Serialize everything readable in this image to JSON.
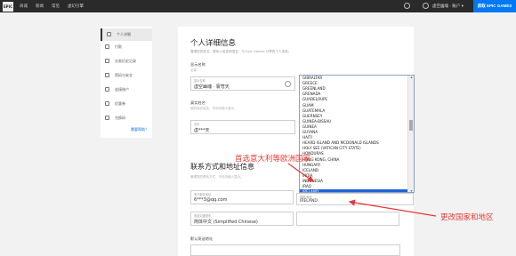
{
  "nav": {
    "logo": "EPIC",
    "links": [
      "商城",
      "新闻",
      "常见",
      "虚幻引擎"
    ],
    "username": "虚空幽魂 · 账户 ▾",
    "get_button": "获取 EPIC GAMES"
  },
  "sidebar": {
    "items": [
      {
        "label": "个人详细",
        "icon": "person-icon",
        "active": true
      },
      {
        "label": "付款",
        "icon": "card-icon"
      },
      {
        "label": "交易历史记录",
        "icon": "history-icon"
      },
      {
        "label": "密码与安全",
        "icon": "key-icon"
      },
      {
        "label": "连接账户",
        "icon": "link-icon"
      },
      {
        "label": "优惠券",
        "icon": "coupon-icon"
      },
      {
        "label": "兑换码",
        "icon": "redeem-icon"
      }
    ],
    "help": "需要帮助？"
  },
  "main": {
    "title": "个人详细信息",
    "desc": "管理您的姓名、联系人信息和语言，与 Epic Games 分享的个人信息。",
    "display_name_label": "显示名称",
    "display_name_sub": "必填",
    "display_name_field_label": "显示名称",
    "display_name_value": "虚空幽魂 · 寰穹天",
    "real_name_label": "真实姓名",
    "real_name_sub": "您的真实姓名，不可向他人显示。",
    "real_name_field_label": "名字",
    "real_name_value": "虚***天",
    "contact_title": "联系方式和地址信息",
    "contact_sub": "管理您的联系方式，不可向他人显示。",
    "email_field_label": "电子邮件地址",
    "email_value": "6***3@qq.com",
    "language_field_label": "首选沟通语言",
    "language_value": "简体中文 (Simplified Chinese)",
    "address_label": "默认寄送地址"
  },
  "dropdown": {
    "options": [
      "GIBRALTAR",
      "GREECE",
      "GREENLAND",
      "GRENADA",
      "GUADELOUPE",
      "GUAM",
      "GUATEMALA",
      "GUERNSEY",
      "GUINEA-BISSAU",
      "GUINEA",
      "GUYANA",
      "HAITI",
      "HEARD ISLAND AND MCDONALD ISLANDS",
      "HOLY SEE (VATICAN CITY STATE)",
      "HONDURAS",
      "HONG KONG, CHINA",
      "HUNGARY",
      "ICELAND",
      "INDIA",
      "INDONESIA",
      "IRAQ",
      "IRELAND"
    ],
    "selected": "IRELAND"
  },
  "country_select": {
    "label": "国家/地区",
    "value": "IRELAND"
  },
  "annotations": {
    "left": "首选意大利等欧洲国家",
    "right": "更改国家和地区"
  },
  "colors": {
    "accent": "#0078f2",
    "annotation": "#e53935",
    "selected_option": "#1e63d6"
  }
}
